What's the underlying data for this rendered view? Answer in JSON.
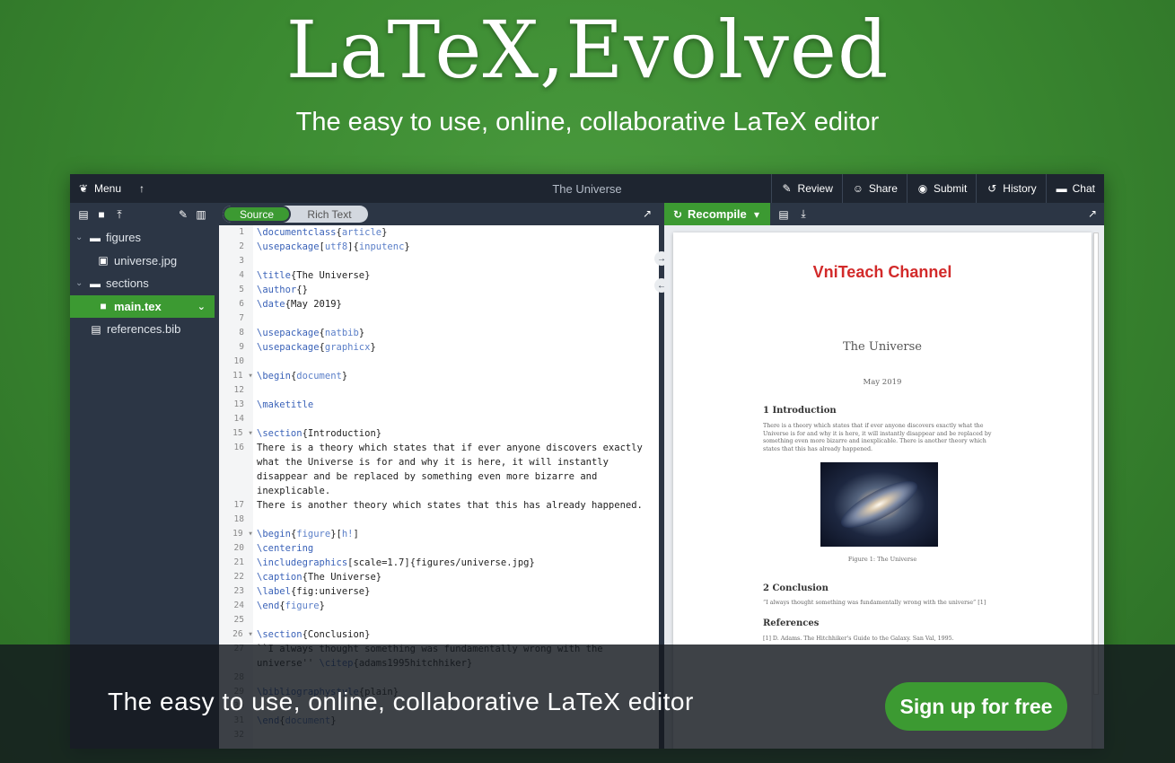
{
  "hero": {
    "title": "LaTeX,Evolved",
    "subtitle": "The easy to use, online, collaborative LaTeX editor"
  },
  "topbar": {
    "menu_label": "Menu",
    "project_title": "The Universe",
    "review_label": "Review",
    "share_label": "Share",
    "submit_label": "Submit",
    "history_label": "History",
    "chat_label": "Chat"
  },
  "file_tree": {
    "items": [
      {
        "label": "figures",
        "type": "folder"
      },
      {
        "label": "universe.jpg",
        "type": "image"
      },
      {
        "label": "sections",
        "type": "folder"
      },
      {
        "label": "main.tex",
        "type": "file",
        "selected": true
      },
      {
        "label": "references.bib",
        "type": "file"
      }
    ]
  },
  "editor": {
    "source_tab": "Source",
    "rich_text_tab": "Rich Text",
    "lines": [
      {
        "n": "1",
        "c": "\\documentclass{article}"
      },
      {
        "n": "2",
        "c": "\\usepackage[utf8]{inputenc}"
      },
      {
        "n": "3",
        "c": ""
      },
      {
        "n": "4",
        "c": "\\title{The Universe}"
      },
      {
        "n": "5",
        "c": "\\author{}"
      },
      {
        "n": "6",
        "c": "\\date{May 2019}"
      },
      {
        "n": "7",
        "c": ""
      },
      {
        "n": "8",
        "c": "\\usepackage{natbib}"
      },
      {
        "n": "9",
        "c": "\\usepackage{graphicx}"
      },
      {
        "n": "10",
        "c": ""
      },
      {
        "n": "11",
        "c": "\\begin{document}",
        "fold": true
      },
      {
        "n": "12",
        "c": ""
      },
      {
        "n": "13",
        "c": "\\maketitle"
      },
      {
        "n": "14",
        "c": ""
      },
      {
        "n": "15",
        "c": "\\section{Introduction}",
        "fold": true
      },
      {
        "n": "16",
        "c": "There is a theory which states that if ever anyone discovers exactly"
      },
      {
        "n": "",
        "c": "what the Universe is for and why it is here, it will instantly"
      },
      {
        "n": "",
        "c": "disappear and be replaced by something even more bizarre and"
      },
      {
        "n": "",
        "c": "inexplicable."
      },
      {
        "n": "17",
        "c": "There is another theory which states that this has already happened."
      },
      {
        "n": "18",
        "c": ""
      },
      {
        "n": "19",
        "c": "\\begin{figure}[h!]",
        "fold": true
      },
      {
        "n": "20",
        "c": "\\centering"
      },
      {
        "n": "21",
        "c": "\\includegraphics[scale=1.7]{figures/universe.jpg}"
      },
      {
        "n": "22",
        "c": "\\caption{The Universe}"
      },
      {
        "n": "23",
        "c": "\\label{fig:universe}"
      },
      {
        "n": "24",
        "c": "\\end{figure}"
      },
      {
        "n": "25",
        "c": ""
      },
      {
        "n": "26",
        "c": "\\section{Conclusion}",
        "fold": true
      },
      {
        "n": "27",
        "c": "``I always thought something was fundamentally wrong with the"
      },
      {
        "n": "",
        "c": "universe'' \\citep{adams1995hitchhiker}"
      },
      {
        "n": "28",
        "c": ""
      },
      {
        "n": "29",
        "c": "\\bibliographystyle{plain}"
      },
      {
        "n": "30",
        "c": ""
      },
      {
        "n": "31",
        "c": "\\end{document}"
      },
      {
        "n": "32",
        "c": ""
      }
    ]
  },
  "pdf": {
    "recompile_label": "Recompile",
    "watermark": "VniTeach Channel",
    "doc_title": "The Universe",
    "doc_date": "May 2019",
    "section1": "1   Introduction",
    "section1_body": "There is a theory which states that if ever anyone discovers exactly what the Universe is for and why it is here, it will instantly disappear and be replaced by something even more bizarre and inexplicable. There is another theory which states that this has already happened.",
    "figure_caption": "Figure 1: The Universe",
    "section2": "2   Conclusion",
    "section2_body": "“I always thought something was fundamentally wrong with the universe” [1]",
    "references_heading": "References",
    "reference1": "[1]  D. Adams. The Hitchhiker's Guide to the Galaxy. San Val, 1995."
  },
  "footer": {
    "tagline": "The easy to use, online, collaborative LaTeX editor",
    "signup_label": "Sign up for free"
  },
  "colors": {
    "brand_green": "#3c9a32",
    "toolbar_dark": "#1e2530",
    "panel_dark": "#2c3645",
    "watermark_red": "#d22a2a"
  }
}
